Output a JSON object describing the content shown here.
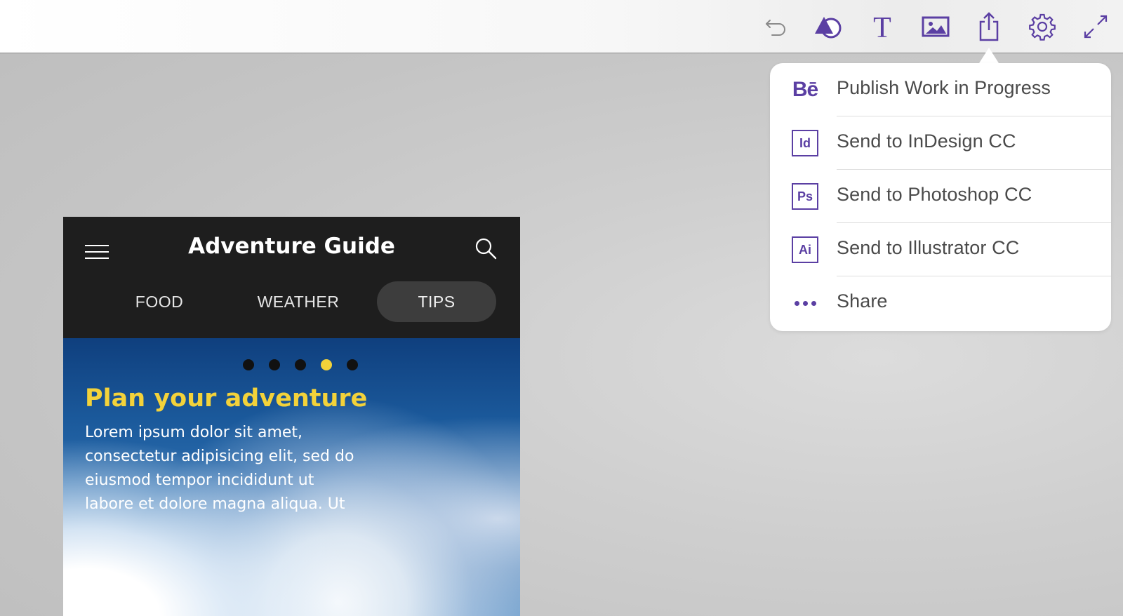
{
  "toolbar": {
    "buttons": [
      {
        "name": "undo-icon"
      },
      {
        "name": "shapes-icon"
      },
      {
        "name": "text-icon"
      },
      {
        "name": "image-icon"
      },
      {
        "name": "share-icon"
      },
      {
        "name": "settings-icon"
      },
      {
        "name": "fullscreen-icon"
      }
    ],
    "accent_color": "#5b3fa3"
  },
  "share_menu": {
    "items": [
      {
        "label": "Publish Work in Progress",
        "icon": "behance-icon",
        "icon_text": "Bē"
      },
      {
        "label": "Send to InDesign CC",
        "icon": "indesign-icon",
        "icon_text": "Id"
      },
      {
        "label": "Send to Photoshop CC",
        "icon": "photoshop-icon",
        "icon_text": "Ps"
      },
      {
        "label": "Send to Illustrator CC",
        "icon": "illustrator-icon",
        "icon_text": "Ai"
      },
      {
        "label": "Share",
        "icon": "more-dots-icon"
      }
    ]
  },
  "app": {
    "title": "Adventure Guide",
    "tabs": [
      {
        "label": "FOOD",
        "active": false
      },
      {
        "label": "WEATHER",
        "active": false
      },
      {
        "label": "TIPS",
        "active": true
      }
    ],
    "pager": {
      "count": 5,
      "active_index": 4
    },
    "hero": {
      "title": "Plan your adventure",
      "body": "Lorem ipsum dolor sit amet, consectetur adipisicing elit, sed do eiusmod tempor incididunt ut labore et dolore magna aliqua. Ut"
    },
    "colors": {
      "header_bg": "#1e1e1e",
      "highlight": "#f3d23a"
    }
  }
}
